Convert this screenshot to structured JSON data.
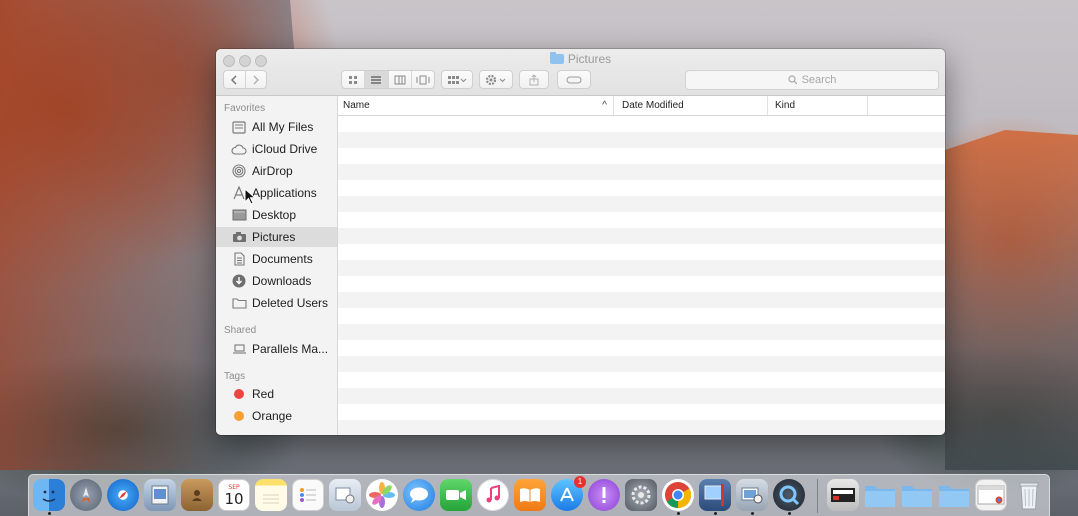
{
  "window": {
    "title": "Pictures",
    "search_placeholder": "Search"
  },
  "sidebar": {
    "favorites_heading": "Favorites",
    "favorites": [
      {
        "label": "All My Files",
        "icon": "all-files-icon"
      },
      {
        "label": "iCloud Drive",
        "icon": "cloud-icon"
      },
      {
        "label": "AirDrop",
        "icon": "airdrop-icon"
      },
      {
        "label": "Applications",
        "icon": "applications-icon"
      },
      {
        "label": "Desktop",
        "icon": "desktop-icon"
      },
      {
        "label": "Pictures",
        "icon": "camera-icon",
        "selected": true
      },
      {
        "label": "Documents",
        "icon": "documents-icon"
      },
      {
        "label": "Downloads",
        "icon": "download-icon"
      },
      {
        "label": "Deleted Users",
        "icon": "folder-icon"
      }
    ],
    "shared_heading": "Shared",
    "shared": [
      {
        "label": "Parallels Ma...",
        "icon": "computer-icon"
      }
    ],
    "tags_heading": "Tags",
    "tags": [
      {
        "label": "Red",
        "color": "#e9473f"
      },
      {
        "label": "Orange",
        "color": "#f6a033"
      }
    ]
  },
  "list": {
    "columns": [
      "Name",
      "Date Modified",
      "Kind"
    ],
    "sort_indicator": "^"
  },
  "dock": {
    "calendar_month": "SEP",
    "calendar_day": "10",
    "appstore_badge": "1"
  }
}
